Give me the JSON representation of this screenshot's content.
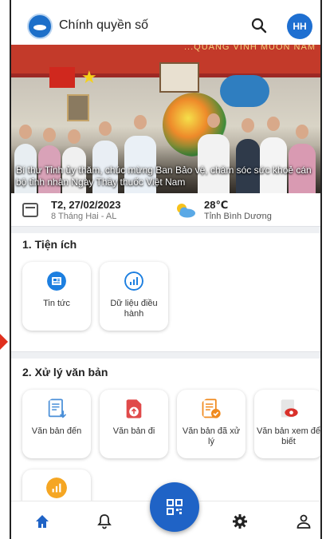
{
  "header": {
    "app_title": "Chính quyền số",
    "avatar_initials": "HH"
  },
  "banner": {
    "top_text": "...QUANG VINH MUÔN NĂM",
    "caption": "Bí thư Tỉnh ủy thăm, chúc mừng Ban Bảo vệ, chăm sóc sức khoẻ cán bộ tỉnh nhân Ngày Thầy thuốc Việt Nam"
  },
  "info": {
    "date": "T2, 27/02/2023",
    "lunar_date": "8 Tháng Hai - AL",
    "temperature": "28℃",
    "location": "Tỉnh Bình Dương"
  },
  "sections": [
    {
      "title": "1. Tiện ích",
      "items": [
        {
          "label": "Tin tức",
          "icon": "news-icon",
          "color": "#1d7fe0"
        },
        {
          "label": "Dữ liệu điều hành",
          "icon": "chart-data-icon",
          "color": "#1d7fe0"
        }
      ]
    },
    {
      "title": "2. Xử lý văn bản",
      "items": [
        {
          "label": "Văn bản đến",
          "icon": "incoming-document-icon",
          "color": "#4a8fd8"
        },
        {
          "label": "Văn bản đi",
          "icon": "outgoing-document-icon",
          "color": "#e04a4a"
        },
        {
          "label": "Văn bản đã xử lý",
          "icon": "processed-document-icon",
          "color": "#f08a1e"
        },
        {
          "label": "Văn bản xem để biết",
          "icon": "view-document-icon",
          "color": "#d9302a"
        },
        {
          "label": "",
          "icon": "report-chart-icon",
          "color": "#f5a623"
        }
      ]
    }
  ],
  "bottom_nav": [
    "home-icon",
    "bell-icon",
    "qr-code-icon",
    "gear-icon",
    "user-icon"
  ],
  "colors": {
    "primary": "#1f63c6",
    "divider": "#eef0f3"
  }
}
